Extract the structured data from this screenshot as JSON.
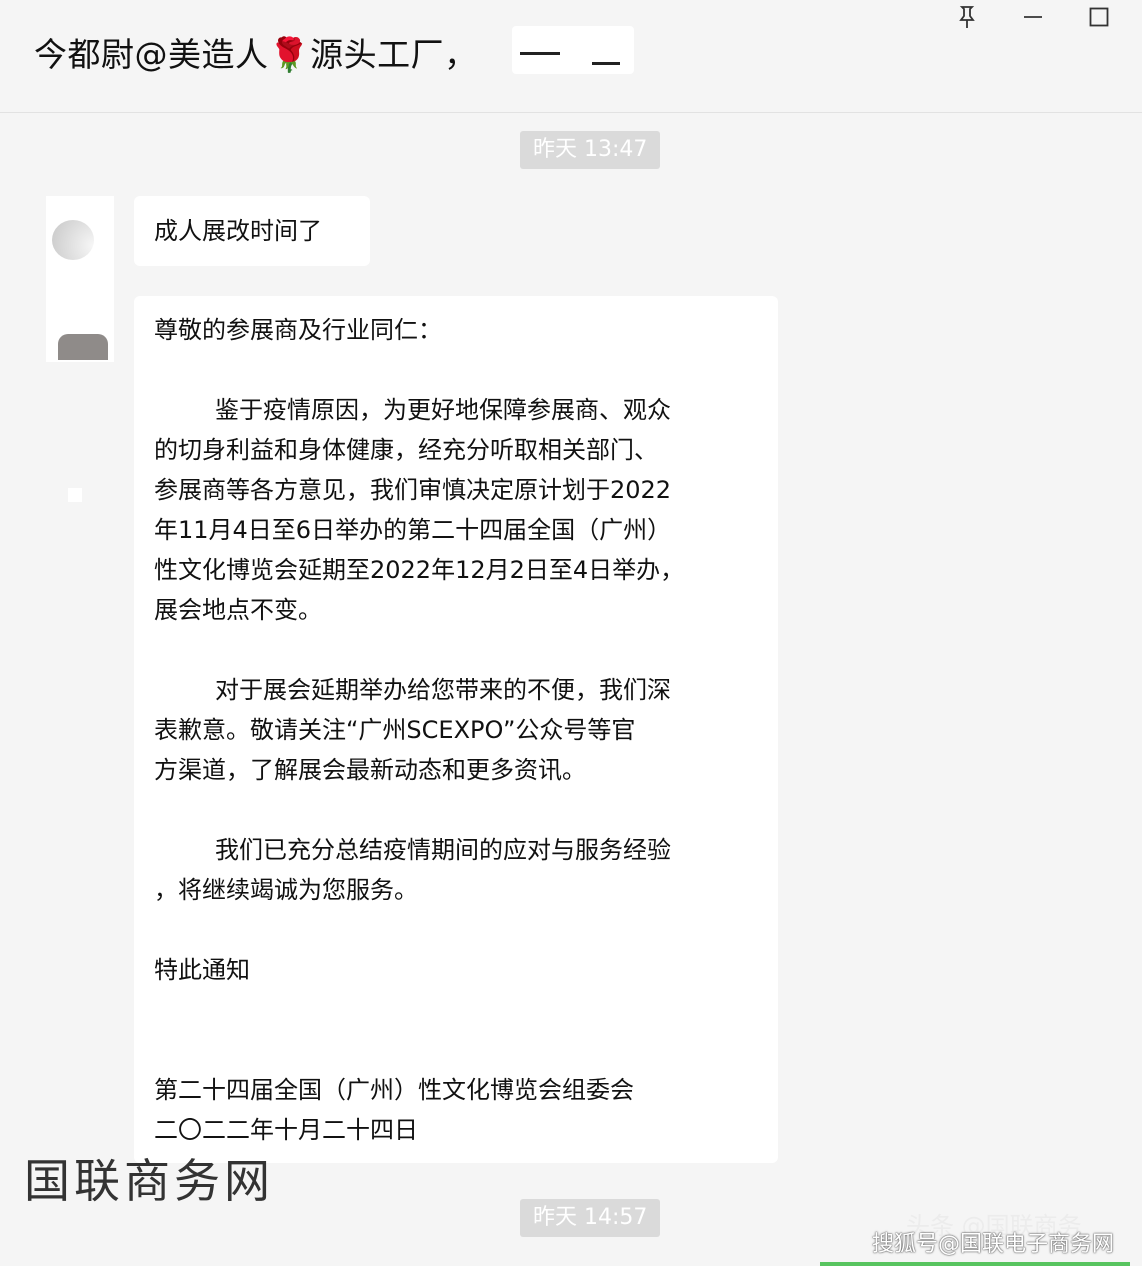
{
  "window": {
    "title": "今都尉@美造人🌹源头工厂，",
    "buttons": {
      "pin": "pin-icon",
      "minimize": "minimize-icon",
      "maximize": "maximize-icon"
    }
  },
  "timestamps": [
    "昨天 13:47",
    "昨天 14:57"
  ],
  "messages": [
    {
      "text": "成人展改时间了"
    },
    {
      "lines": [
        "尊敬的参展商及行业同仁：",
        "",
        "        鉴于疫情原因，为更好地保障参展商、观众",
        "的切身利益和身体健康，经充分听取相关部门、",
        "参展商等各方意见，我们审慎决定原计划于2022",
        "年11月4日至6日举办的第二十四届全国（广州）",
        "性文化博览会延期至2022年12月2日至4日举办，",
        "展会地点不变。",
        "",
        "        对于展会延期举办给您带来的不便，我们深",
        "表歉意。敬请关注“广州SCEXPO”公众号等官",
        "方渠道，了解展会最新动态和更多资讯。",
        "",
        "        我们已充分总结疫情期间的应对与服务经验",
        "，将继续竭诚为您服务。",
        "",
        "特此通知",
        "",
        "",
        "第二十四届全国（广州）性文化博览会组委会",
        "二〇二二年十月二十四日"
      ]
    }
  ],
  "watermarks": {
    "left": "国联商务网",
    "toutiao": "头条 @国联商务",
    "sohu": "搜狐号@国联电子商务网"
  },
  "colors": {
    "background": "#f5f5f5",
    "bubble": "#ffffff",
    "timestamp_bg": "#dadada",
    "accent_green": "#58c45f"
  }
}
